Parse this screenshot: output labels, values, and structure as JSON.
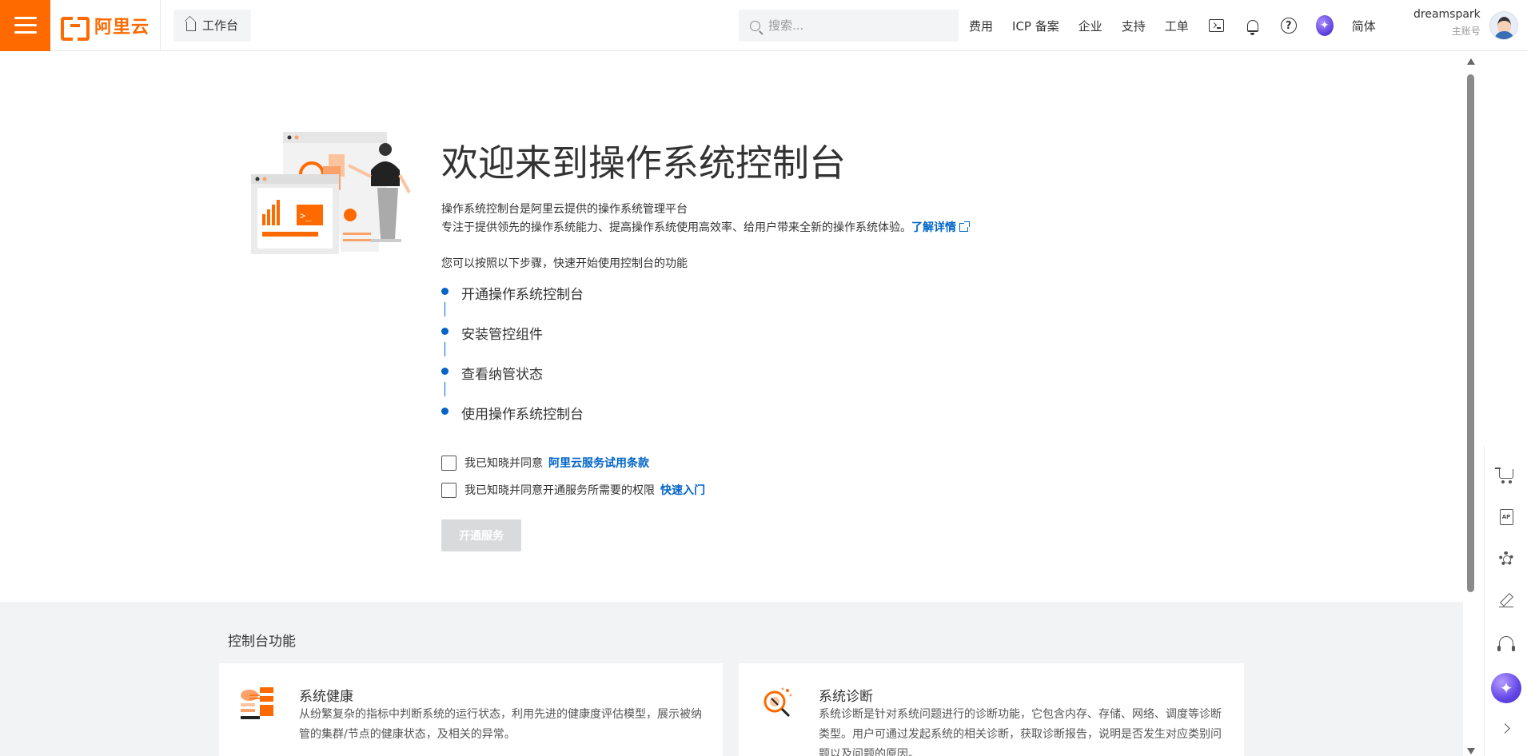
{
  "header": {
    "logo_text": "阿里云",
    "workbench_label": "工作台",
    "search_placeholder": "搜索...",
    "nav": [
      "费用",
      "ICP 备案",
      "企业",
      "支持",
      "工单"
    ],
    "lang_label": "简体",
    "user_name": "dreamspark",
    "user_role": "主账号"
  },
  "main": {
    "title": "欢迎来到操作系统控制台",
    "desc_line1": "操作系统控制台是阿里云提供的操作系统管理平台",
    "desc_line2": "专注于提供领先的操作系统能力、提高操作系统使用高效率、给用户带来全新的操作系统体验。",
    "learn_more": "了解详情",
    "steps_intro": "您可以按照以下步骤，快速开始使用控制台的功能",
    "steps": [
      "开通操作系统控制台",
      "安装管控组件",
      "查看纳管状态",
      "使用操作系统控制台"
    ],
    "agree1_text": "我已知晓并同意",
    "agree1_link": "阿里云服务试用条款",
    "agree2_text": "我已知晓并同意开通服务所需要的权限",
    "agree2_link": "快速入门",
    "open_button": "开通服务"
  },
  "features": {
    "title": "控制台功能",
    "cards": [
      {
        "title": "系统健康",
        "desc": "从纷繁复杂的指标中判断系统的运行状态，利用先进的健康度评估模型，展示被纳管的集群/节点的健康状态，及相关的异常。"
      },
      {
        "title": "系统诊断",
        "desc": "系统诊断是针对系统问题进行的诊断功能，它包含内存、存储、网络、调度等诊断类型。用户可通过发起系统的相关诊断，获取诊断报告，说明是否发生对应类别问题以及问题的原因。"
      }
    ]
  },
  "colors": {
    "brand": "#ff6a00",
    "link": "#0064c8",
    "disabled_button": "#d9dadc"
  }
}
